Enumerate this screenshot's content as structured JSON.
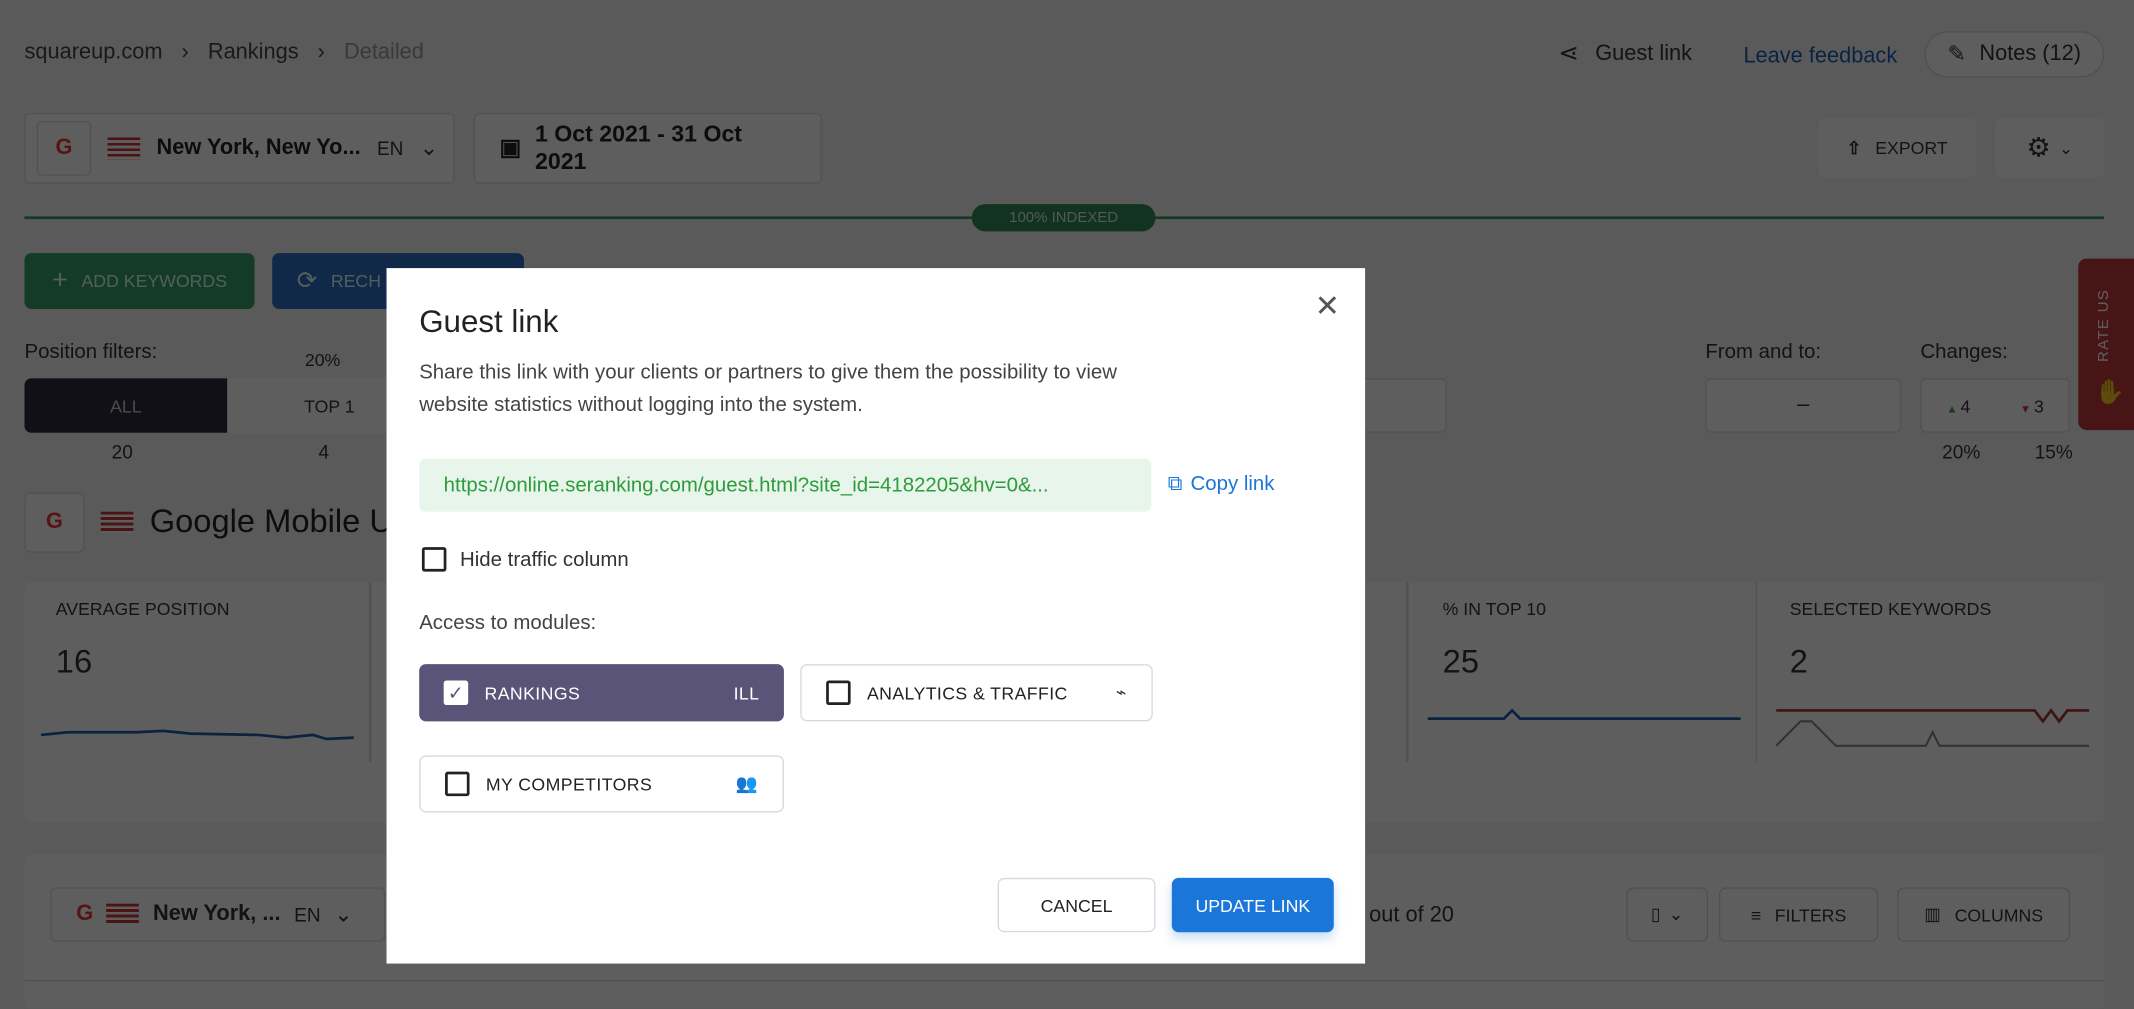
{
  "breadcrumb": [
    "squareup.com",
    "Rankings",
    "Detailed"
  ],
  "header": {
    "guest_link": "Guest link",
    "leave_feedback": "Leave feedback",
    "notes": "Notes (12)"
  },
  "toolbar": {
    "location": "New York, New Yo...",
    "lang": "EN",
    "date_range": "1 Oct 2021 - 31 Oct 2021",
    "export": "EXPORT"
  },
  "indexed": "100% INDEXED",
  "actions": {
    "add_keywords": "ADD KEYWORDS",
    "recheck": "RECH"
  },
  "filters": {
    "label": "Position filters:",
    "top1_pct": "20%",
    "all": "ALL",
    "top1": "TOP 1",
    "all_count": "20",
    "top1_count": "4",
    "from_to": "From and to:",
    "from_to_value": "–",
    "changes": "Changes:",
    "up": "4",
    "down": "3",
    "up_pct": "20%",
    "down_pct": "15%"
  },
  "rate_us": "RATE US",
  "engine_title": "Google Mobile U",
  "stats": [
    {
      "label": "AVERAGE POSITION",
      "value": "16"
    },
    {
      "label": "% IN TOP 10",
      "value": "25"
    },
    {
      "label": "SELECTED KEYWORDS",
      "value": "2"
    }
  ],
  "table_toolbar": {
    "location": "New York, ...",
    "lang": "EN",
    "count": "out of 20",
    "filters": "FILTERS",
    "columns": "COLUMNS"
  },
  "modal": {
    "title": "Guest link",
    "description": "Share this link with your clients or partners to give them the possibility to view website statistics without logging into the system.",
    "url": "https://online.seranking.com/guest.html?site_id=4182205&hv=0&...",
    "copy": "Copy link",
    "hide_traffic": "Hide traffic column",
    "hide_traffic_checked": false,
    "access_label": "Access to modules:",
    "modules": [
      {
        "label": "RANKINGS",
        "checked": true,
        "icon": "bar-chart-icon"
      },
      {
        "label": "ANALYTICS & TRAFFIC",
        "checked": false,
        "icon": "pulse-icon"
      },
      {
        "label": "MY COMPETITORS",
        "checked": false,
        "icon": "users-icon"
      }
    ],
    "cancel": "CANCEL",
    "update": "UPDATE LINK"
  },
  "colors": {
    "accent": "#1a76d8",
    "green": "#2e9b3c",
    "purple": "#5a5478",
    "rate_red": "#c0383a"
  }
}
